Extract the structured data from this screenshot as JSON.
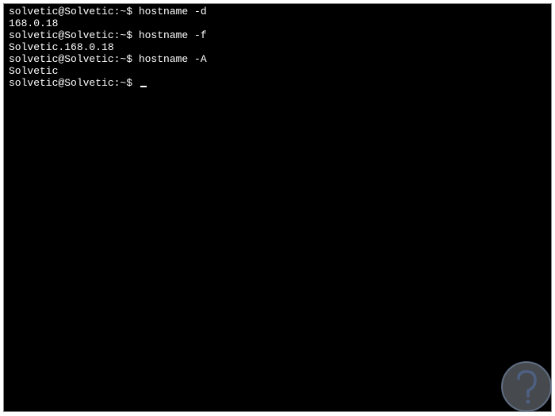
{
  "terminal": {
    "lines": [
      {
        "prompt": "solvetic@Solvetic:~$ ",
        "command": "hostname -d"
      },
      {
        "output": "168.0.18"
      },
      {
        "prompt": "solvetic@Solvetic:~$ ",
        "command": "hostname -f"
      },
      {
        "output": "Solvetic.168.0.18"
      },
      {
        "prompt": "solvetic@Solvetic:~$ ",
        "command": "hostname -A"
      },
      {
        "output": "Solvetic"
      },
      {
        "prompt": "solvetic@Solvetic:~$ ",
        "command": ""
      }
    ]
  },
  "watermark": {
    "name": "solvetic-logo"
  }
}
